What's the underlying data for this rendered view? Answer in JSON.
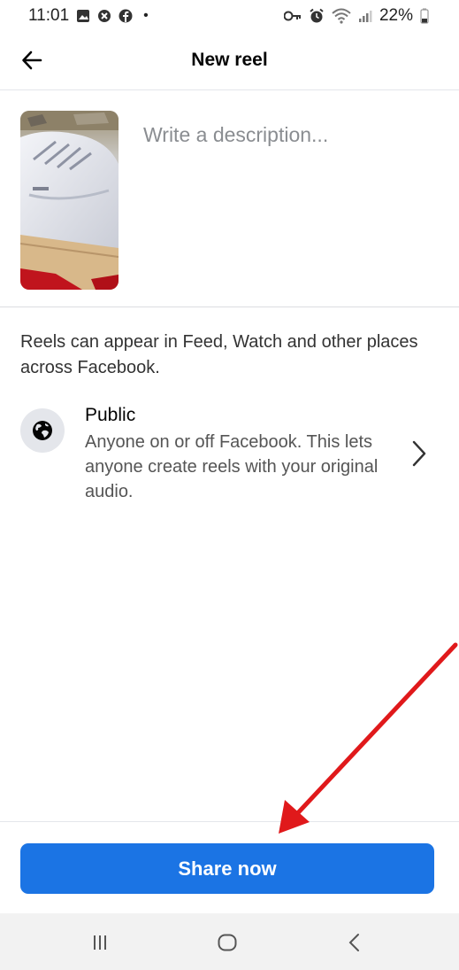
{
  "status_bar": {
    "time": "11:01",
    "battery": "22%",
    "icons_left": [
      "gallery-icon",
      "blocked-icon",
      "facebook-icon",
      "dot"
    ],
    "icons_right": [
      "key-icon",
      "alarm-icon",
      "wifi-icon",
      "signal-icon",
      "battery-icon"
    ]
  },
  "header": {
    "title": "New reel",
    "back_icon": "arrow-left-icon"
  },
  "composer": {
    "description_placeholder": "Write a description..."
  },
  "info": {
    "text": "Reels can appear in Feed, Watch and other places across Facebook."
  },
  "privacy": {
    "title": "Public",
    "subtitle": "Anyone on or off Facebook. This lets anyone create reels with your original audio.",
    "icon": "globe-icon",
    "chevron": "chevron-right-icon"
  },
  "actions": {
    "share_label": "Share now",
    "button_color": "#1b74e4"
  },
  "nav_bar": {
    "items": [
      "recent-apps-icon",
      "home-icon",
      "back-icon"
    ]
  },
  "annotation": {
    "arrow_color": "#e0191b"
  }
}
